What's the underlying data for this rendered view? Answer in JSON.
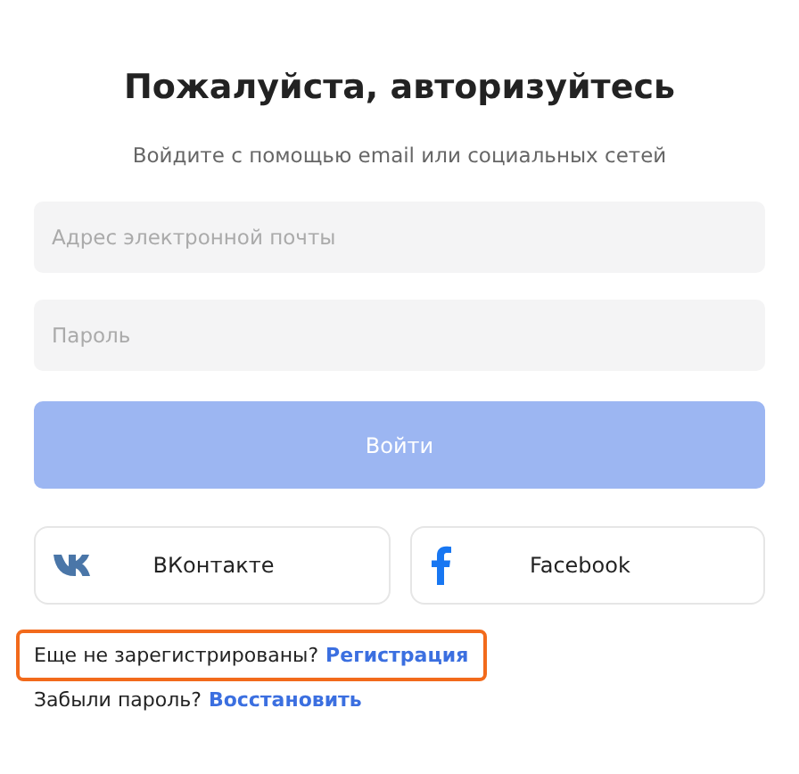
{
  "title": "Пожалуйста, авторизуйтесь",
  "subtitle": "Войдите с помощью email или социальных сетей",
  "fields": [
    {
      "placeholder": "Адрес электронной почты"
    },
    {
      "placeholder": "Пароль"
    }
  ],
  "submit": {
    "label": "Войти",
    "disabled": true
  },
  "social": [
    {
      "kind": "vk",
      "label": "ВКонтакте"
    },
    {
      "kind": "facebook",
      "label": "Facebook"
    }
  ],
  "links": [
    {
      "text": "Еще не зарегистрированы?",
      "link": "Регистрация",
      "highlighted": true
    },
    {
      "text": "Забыли пароль?",
      "link": "Восстановить",
      "highlighted": false
    }
  ]
}
